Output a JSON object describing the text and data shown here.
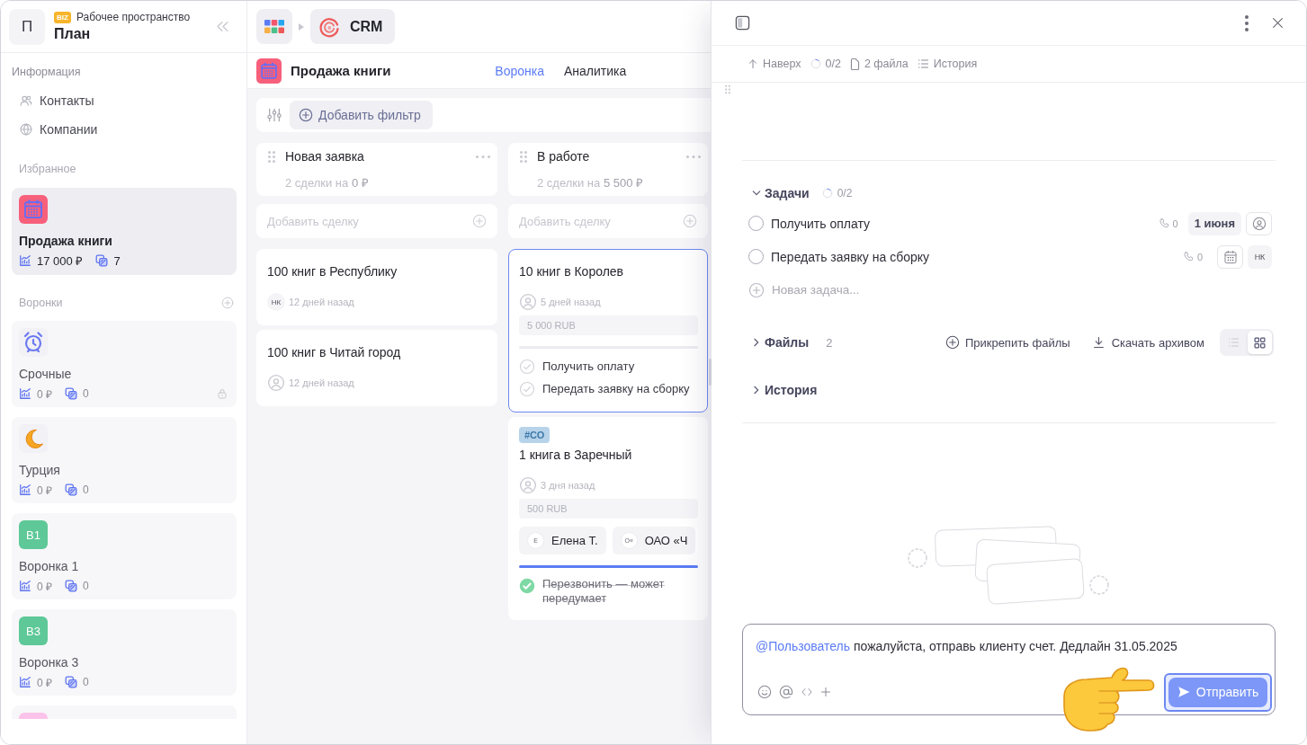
{
  "sidebar": {
    "workspace": {
      "avatar": "П",
      "plan_badge": "BIZ",
      "label": "Рабочее пространство",
      "name": "План"
    },
    "info": {
      "title": "Информация",
      "items": [
        {
          "kind": "contacts",
          "label": "Контакты"
        },
        {
          "kind": "companies",
          "label": "Компании"
        }
      ]
    },
    "favorites": {
      "title": "Избранное",
      "items": [
        {
          "kind": "calendar",
          "title": "Продажа книги",
          "amount": "17 000 ₽",
          "deals": "7",
          "selected": true,
          "locked": false
        }
      ]
    },
    "pipelines": {
      "title": "Воронки",
      "items": [
        {
          "kind": "alarm",
          "title": "Срочные",
          "amount": "0 ₽",
          "deals": "0",
          "selected": false,
          "locked": true
        },
        {
          "kind": "moon",
          "title": "Турция",
          "amount": "0 ₽",
          "deals": "0",
          "selected": false,
          "locked": false
        },
        {
          "kind": "badge",
          "badge": "В1",
          "color": "#5ec898",
          "title": "Воронка 1",
          "amount": "0 ₽",
          "deals": "0",
          "selected": false,
          "locked": false
        },
        {
          "kind": "badge",
          "badge": "В3",
          "color": "#5ec898",
          "title": "Воронка 3",
          "amount": "0 ₽",
          "deals": "0",
          "selected": false,
          "locked": false
        },
        {
          "kind": "badge",
          "color": "#fbc3ea",
          "selected": false
        }
      ]
    }
  },
  "topbar": {
    "app": "CRM"
  },
  "board": {
    "title": "Продажа книги",
    "tabs": [
      {
        "label": "Воронка",
        "selected": true
      },
      {
        "label": "Аналитика",
        "selected": false
      }
    ],
    "add_filter": "Добавить фильтр",
    "columns": [
      {
        "title": "Новая заявка",
        "summary": "2 сделки на **0 ₽**",
        "add_placeholder": "Добавить сделку",
        "deals": [
          {
            "title": "100 книг в Республику",
            "owner_initials": "НК",
            "age": "12 дней назад",
            "selected": false
          },
          {
            "title": "100 книг в Читай город",
            "age": "12 дней назад",
            "selected": false
          }
        ]
      },
      {
        "title": "В работе",
        "summary": "2 сделки на **5 500 ₽**",
        "add_placeholder": "Добавить сделку",
        "deals": [
          {
            "title": "10 книг в Королев",
            "age": "5 дней назад",
            "amount": "5 000 RUB",
            "progress": {
              "level": 0
            },
            "tasks": [
              {
                "label": "Получить оплату",
                "done": false
              },
              {
                "label": "Передать заявку на сборку",
                "done": false
              }
            ],
            "selected": true
          },
          {
            "tag": "#СО",
            "title": "1 книга в Заречный",
            "age": "3 дня назад",
            "amount": "500 RUB",
            "contacts": [
              {
                "initial": "Е",
                "name": "Елена Т."
              },
              {
                "initial": "О«",
                "name": "ОАО «Ч"
              }
            ],
            "progress": {
              "level": 1
            },
            "tasks": [
              {
                "label": "Перезвонить — может передумает",
                "done": true
              }
            ],
            "selected": false
          }
        ]
      }
    ]
  },
  "detail": {
    "toolbar": [
      {
        "kind": "up",
        "label": "Наверх"
      },
      {
        "kind": "progress",
        "label": "0/2"
      },
      {
        "kind": "files",
        "label": "2 файла"
      },
      {
        "kind": "history",
        "label": "История"
      }
    ],
    "sections": [
      {
        "kind": "tasks",
        "title": "Задачи",
        "expanded": true,
        "progress": "0/2",
        "tasks": [
          {
            "label": "Получить оплату",
            "done": false,
            "calls": "0",
            "due": "1 июня"
          },
          {
            "label": "Передать заявку на сборку",
            "done": false,
            "calls": "0",
            "assignee_initials": "НК"
          }
        ],
        "new_task_placeholder": "Новая задача..."
      },
      {
        "kind": "files",
        "title": "Файлы",
        "expanded": false,
        "count": "2",
        "attach": "Прикрепить файлы",
        "download": "Скачать архивом",
        "views": [
          {
            "kind": "list",
            "selected": false
          },
          {
            "kind": "grid",
            "selected": true
          }
        ]
      },
      {
        "kind": "history",
        "title": "История",
        "expanded": false
      }
    ],
    "composer": {
      "mention": "@Пользователь",
      "text": "пожалуйста, отправь клиенту счет. Дедлайн 31.05.2025",
      "send": "Отправить",
      "send_focused": true
    }
  }
}
